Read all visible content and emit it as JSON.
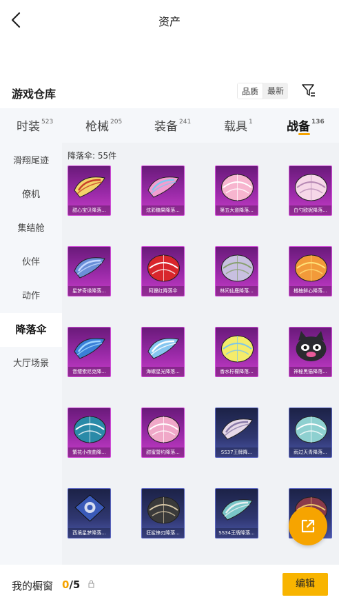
{
  "header": {
    "title": "资产"
  },
  "section": {
    "title": "游戏仓库",
    "sort_options": [
      "品质",
      "最新"
    ],
    "active_sort": "品质"
  },
  "tabs": [
    {
      "label": "时装",
      "count": "523"
    },
    {
      "label": "枪械",
      "count": "205"
    },
    {
      "label": "装备",
      "count": "241"
    },
    {
      "label": "载具",
      "count": "1"
    },
    {
      "label": "战备",
      "count": "136"
    }
  ],
  "active_tab": "战备",
  "sidebar": {
    "items": [
      {
        "label": "滑翔尾迹"
      },
      {
        "label": "僚机"
      },
      {
        "label": "集结舱"
      },
      {
        "label": "伙伴"
      },
      {
        "label": "动作"
      },
      {
        "label": "降落伞"
      },
      {
        "label": "大厅场景"
      }
    ],
    "active": "降落伞"
  },
  "grid": {
    "caption": "降落伞: 55件",
    "items": [
      {
        "name": "甜心宝贝降落...",
        "rarity": "purple",
        "color": "#f4d36a",
        "accent": "#c8402a",
        "shape": "wing"
      },
      {
        "name": "炫彩糖果降落...",
        "rarity": "purple",
        "color": "#f29ed0",
        "accent": "#7ec8f0",
        "shape": "wing"
      },
      {
        "name": "第五大道降落...",
        "rarity": "purple",
        "color": "#f7b5cf",
        "accent": "#ffffff",
        "shape": "dome"
      },
      {
        "name": "白勺欧妮降落...",
        "rarity": "purple",
        "color": "#f6d7e8",
        "accent": "#b689b4",
        "shape": "dome"
      },
      {
        "name": "星梦奇缘降落...",
        "rarity": "purple",
        "color": "#6a8fd8",
        "accent": "#c5d8ff",
        "shape": "wing"
      },
      {
        "name": "阿狸红降落伞",
        "rarity": "purple",
        "color": "#d8262c",
        "accent": "#ffffff",
        "shape": "dome"
      },
      {
        "name": "林间仙鹿降落...",
        "rarity": "purple",
        "color": "#c8c0e0",
        "accent": "#88a070",
        "shape": "dome"
      },
      {
        "name": "橘柚鲜心降落...",
        "rarity": "purple",
        "color": "#f29a3a",
        "accent": "#ffe27a",
        "shape": "dome"
      },
      {
        "name": "音缨索尼克降...",
        "rarity": "purple",
        "color": "#3a80d8",
        "accent": "#9fd6ff",
        "shape": "wing"
      },
      {
        "name": "海螺星光降落...",
        "rarity": "purple",
        "color": "#86c6f0",
        "accent": "#ffffff",
        "shape": "wing"
      },
      {
        "name": "香水柠檬降落...",
        "rarity": "purple",
        "color": "#f4ec6a",
        "accent": "#7dc6e8",
        "shape": "dome"
      },
      {
        "name": "神秘黑猫降落...",
        "rarity": "purple",
        "color": "#2a2a30",
        "accent": "#e85a9a",
        "shape": "cat"
      },
      {
        "name": "繁花小夜曲降...",
        "rarity": "purple",
        "color": "#2a8aa8",
        "accent": "#ffffff",
        "shape": "dome"
      },
      {
        "name": "甜蜜誓约降落...",
        "rarity": "purple",
        "color": "#f0a8c8",
        "accent": "#ffffff",
        "shape": "dome"
      },
      {
        "name": "SS37王牌降...",
        "rarity": "blue",
        "color": "#e6d8e8",
        "accent": "#8a7aa8",
        "shape": "wing"
      },
      {
        "name": "雨过天青降落...",
        "rarity": "blue",
        "color": "#8ed0d0",
        "accent": "#ffffff",
        "shape": "dome"
      },
      {
        "name": "西境星梦降落...",
        "rarity": "blue",
        "color": "#3a5ab8",
        "accent": "#ffffff",
        "shape": "square"
      },
      {
        "name": "狂鲨锋刃降落...",
        "rarity": "blue",
        "color": "#3a3a3a",
        "accent": "#d8c8a8",
        "shape": "dome"
      },
      {
        "name": "SS34王牌降落...",
        "rarity": "blue",
        "color": "#7ac6c8",
        "accent": "#e8f0f0",
        "shape": "wing"
      },
      {
        "name": "",
        "rarity": "blue",
        "color": "#8a3a4a",
        "accent": "#f0c870",
        "shape": "dome"
      }
    ]
  },
  "fab": {
    "icon": "share-external-icon"
  },
  "bottom": {
    "label": "我的橱窗",
    "current": "0",
    "separator": "/",
    "max": "5",
    "edit_label": "编辑"
  },
  "colors": {
    "accent": "#f5a300",
    "button": "#f8b400",
    "sidebar_bg": "#f5f7fa"
  }
}
